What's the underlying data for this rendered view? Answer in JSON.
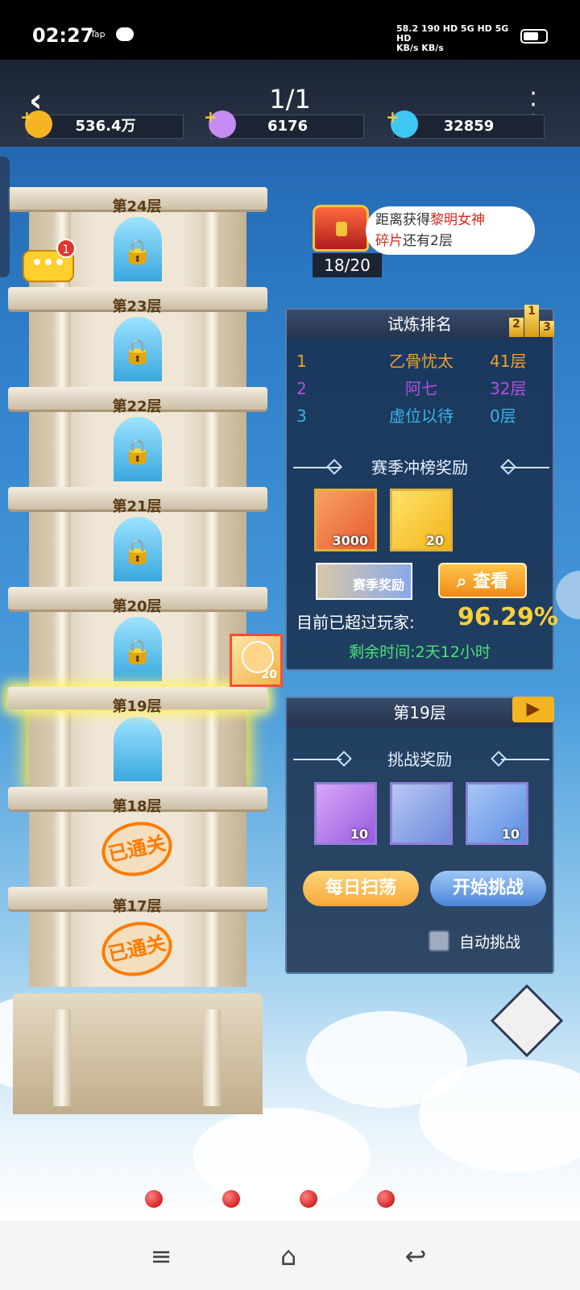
{
  "status": {
    "time": "02:27",
    "tap_label": "Tap",
    "net_line1": "58.2  190 HD 5G HD 5G HD",
    "net_line2": "KB/s  KB/s"
  },
  "header": {
    "page_indicator": "1/1"
  },
  "resources": [
    {
      "value": "536.4万",
      "icon": "gold-coin-icon",
      "color": "#f5b522"
    },
    {
      "value": "6176",
      "icon": "rainbow-crystal-icon",
      "color": "#c48cf3"
    },
    {
      "value": "32859",
      "icon": "blue-diamond-icon",
      "color": "#3ec7f3"
    }
  ],
  "tower": {
    "floors": [
      {
        "label": "第24层",
        "state": "locked"
      },
      {
        "label": "第23层",
        "state": "locked"
      },
      {
        "label": "第22层",
        "state": "locked"
      },
      {
        "label": "第21层",
        "state": "locked"
      },
      {
        "label": "第20层",
        "state": "locked"
      },
      {
        "label": "第19层",
        "state": "current"
      },
      {
        "label": "第18层",
        "state": "cleared"
      },
      {
        "label": "第17层",
        "state": "cleared"
      }
    ],
    "cleared_stamp": "已通关",
    "hero_reward_count": "20",
    "chat_badge": "1",
    "chat_icon_text": "•••"
  },
  "chest_hint": {
    "prefix": "距离获得",
    "highlight_1": "黎明女神",
    "highlight_2": "碎片",
    "suffix": "还有2层",
    "progress": "18/20"
  },
  "ranking": {
    "title": "试炼排名",
    "podium": [
      "2",
      "1",
      "3"
    ],
    "rows": [
      {
        "rank": "1",
        "name": "乙骨忧太",
        "floor": "41层",
        "color": "#f0a12e"
      },
      {
        "rank": "2",
        "name": "阿七",
        "floor": "32层",
        "color": "#b14fe3"
      },
      {
        "rank": "3",
        "name": "虚位以待",
        "floor": "0层",
        "color": "#37b3e8"
      }
    ],
    "season_reward_title": "赛季冲榜奖励",
    "rewards": [
      {
        "count": "3000",
        "icon": "crystal-reward-icon",
        "bg": "#f17b3a"
      },
      {
        "count": "20",
        "icon": "flame-reward-icon",
        "bg": "#f3c22a"
      }
    ],
    "season_tag": "赛季奖励",
    "view_button": "查看",
    "surpass_label": "目前已超过玩家:",
    "surpass_percent": "96.29%",
    "time_left": "剩余时间:2天12小时"
  },
  "challenge": {
    "title": "第19层",
    "reward_title": "挑战奖励",
    "rewards": [
      {
        "count": "10",
        "icon": "purple-orb-icon",
        "bg": "#b97ee8"
      },
      {
        "count": "",
        "icon": "blue-card-icon",
        "bg": "#8fa7e6"
      },
      {
        "count": "10",
        "icon": "potion-bottle-icon",
        "bg": "#7ea7ea"
      }
    ],
    "sweep_button": "每日扫荡",
    "start_button": "开始挑战",
    "auto_label": "自动挑战"
  }
}
